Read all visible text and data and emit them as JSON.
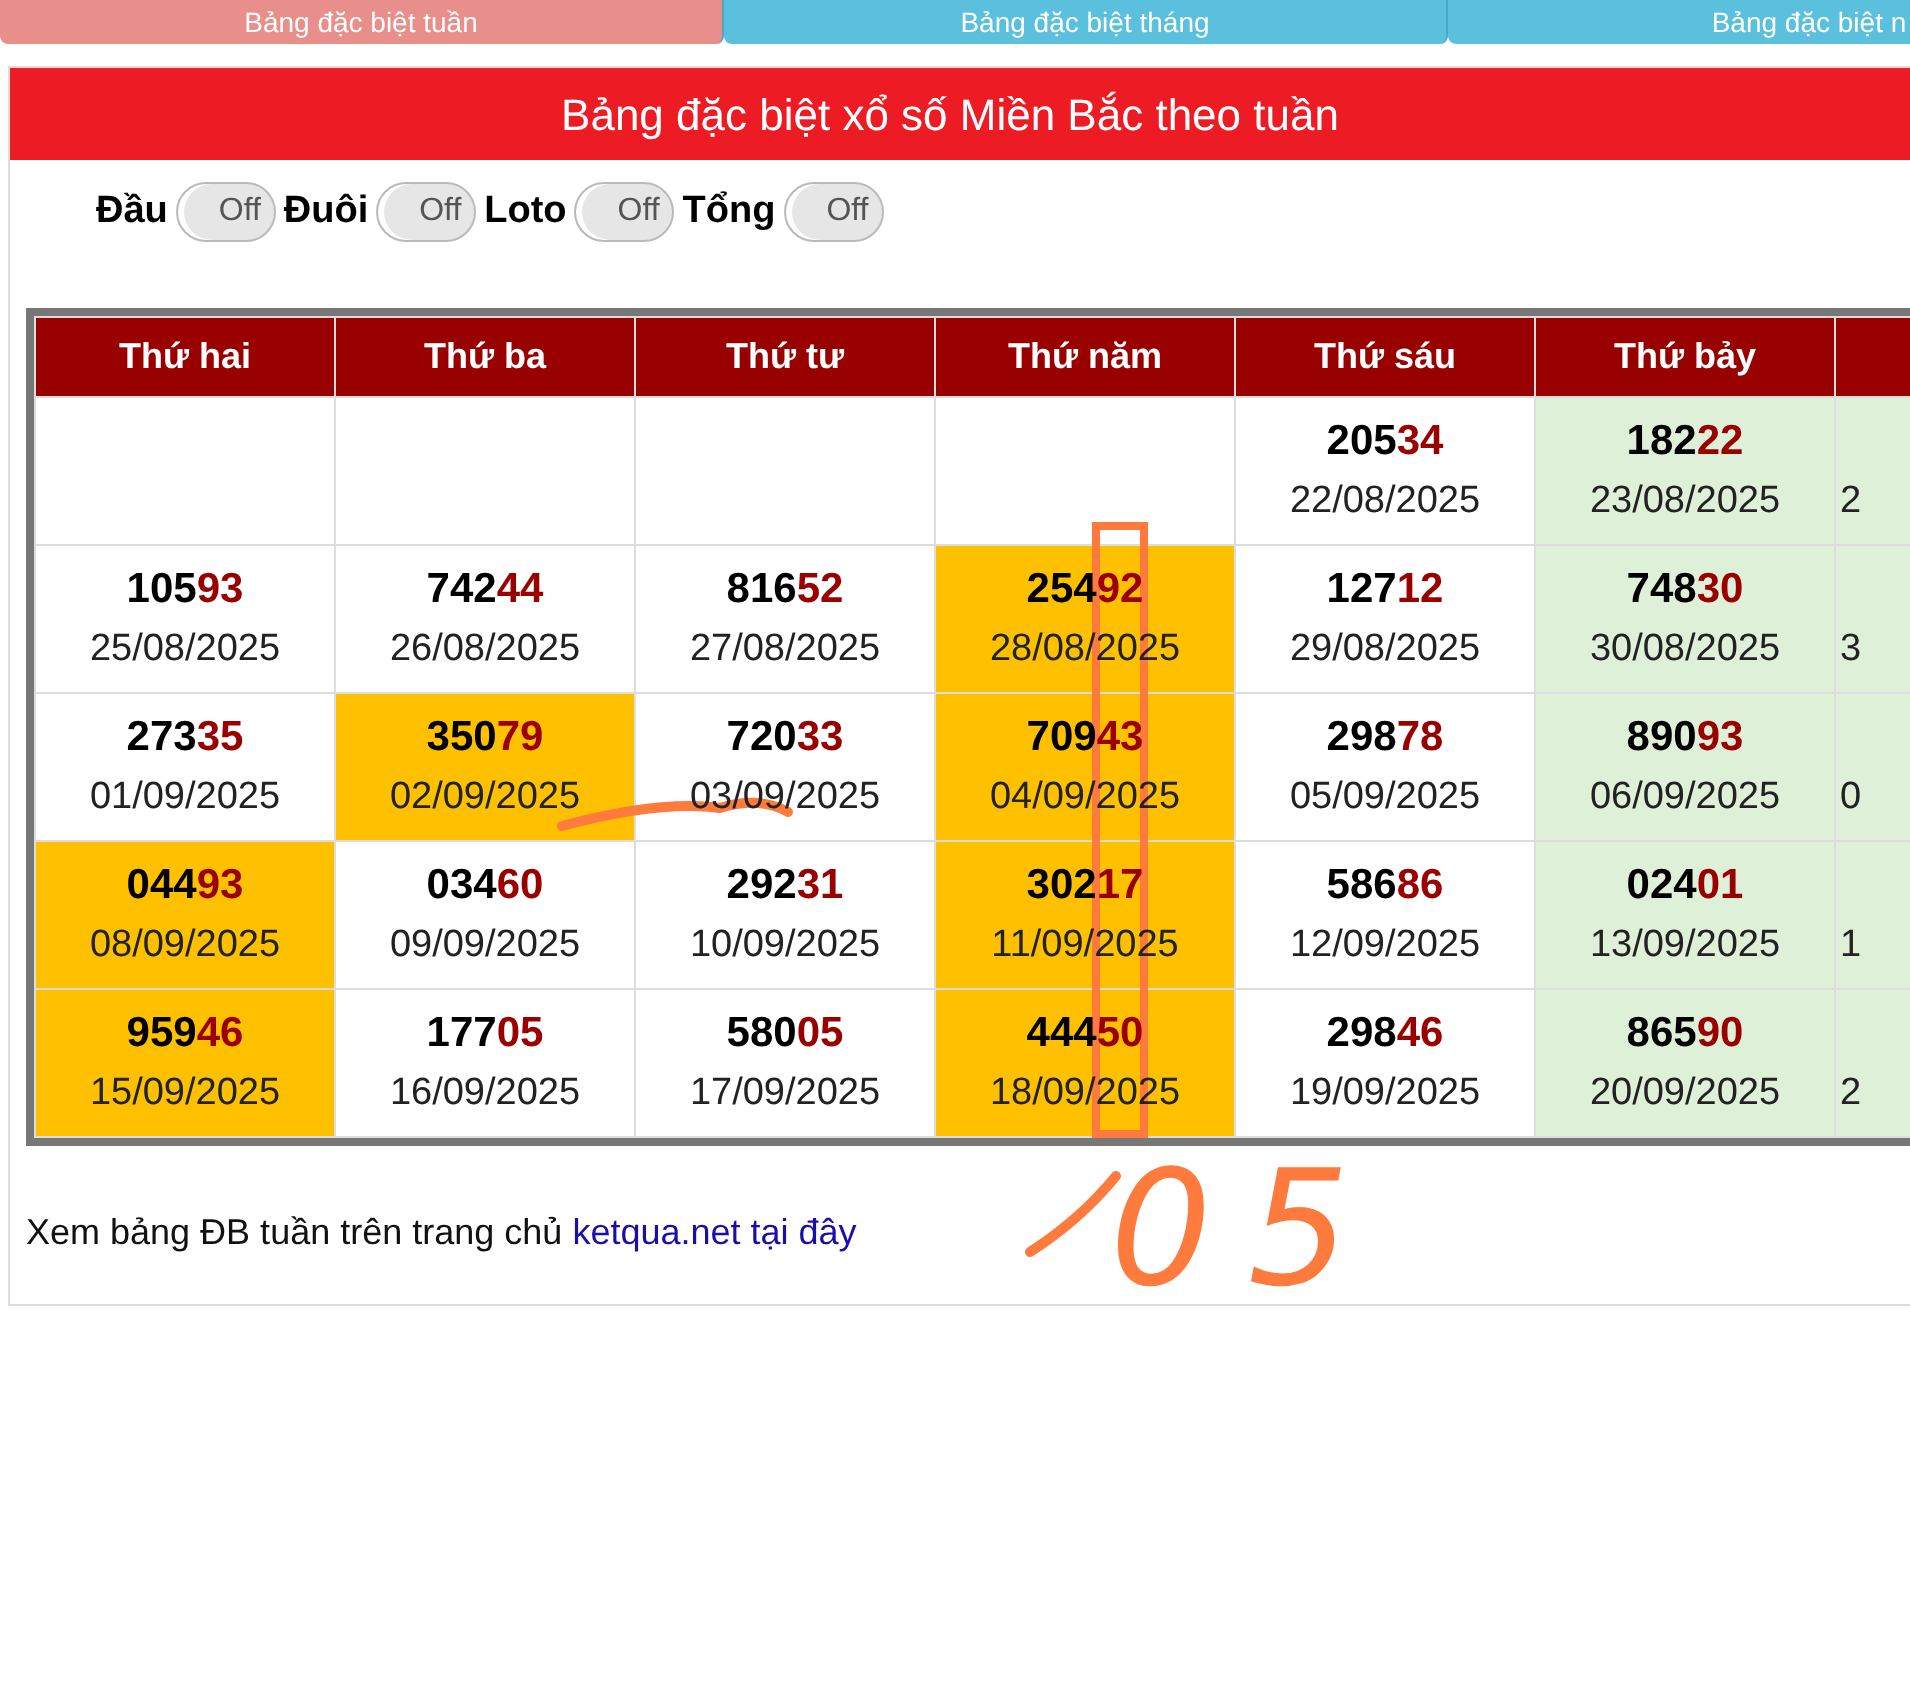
{
  "tabs": [
    {
      "label": "Bảng đặc biệt tuần",
      "selected": true
    },
    {
      "label": "Bảng đặc biệt tháng",
      "selected": false
    },
    {
      "label": "Bảng đặc biệt n",
      "selected": false
    }
  ],
  "title": "Bảng đặc biệt xổ số Miền Bắc theo tuần",
  "toggles": [
    {
      "label": "Đầu",
      "state": "Off",
      "on": false
    },
    {
      "label": "Đuôi",
      "state": "Off",
      "on": false
    },
    {
      "label": "Loto",
      "state": "Off",
      "on": false
    },
    {
      "label": "Tổng",
      "state": "Off",
      "on": false
    }
  ],
  "table": {
    "columns": [
      "Thứ hai",
      "Thứ ba",
      "Thứ tư",
      "Thứ năm",
      "Thứ sáu",
      "Thứ bảy",
      ""
    ],
    "weekend": [
      false,
      false,
      false,
      false,
      false,
      true,
      true
    ],
    "rows": [
      [
        {
          "highlighted": false
        },
        {
          "highlighted": false
        },
        {
          "highlighted": false
        },
        {
          "highlighted": false
        },
        {
          "head": "205",
          "tail": "34",
          "date": "22/08/2025",
          "highlighted": false
        },
        {
          "head": "182",
          "tail": "22",
          "date": "23/08/2025",
          "highlighted": false
        },
        {
          "date": "2",
          "highlighted": false
        }
      ],
      [
        {
          "head": "105",
          "tail": "93",
          "date": "25/08/2025",
          "highlighted": false
        },
        {
          "head": "742",
          "tail": "44",
          "date": "26/08/2025",
          "highlighted": false
        },
        {
          "head": "816",
          "tail": "52",
          "date": "27/08/2025",
          "highlighted": false
        },
        {
          "head": "254",
          "tail": "92",
          "date": "28/08/2025",
          "highlighted": true
        },
        {
          "head": "127",
          "tail": "12",
          "date": "29/08/2025",
          "highlighted": false
        },
        {
          "head": "748",
          "tail": "30",
          "date": "30/08/2025",
          "highlighted": false
        },
        {
          "date": "3",
          "highlighted": false
        }
      ],
      [
        {
          "head": "273",
          "tail": "35",
          "date": "01/09/2025",
          "highlighted": false
        },
        {
          "head": "350",
          "tail": "79",
          "date": "02/09/2025",
          "highlighted": true
        },
        {
          "head": "720",
          "tail": "33",
          "date": "03/09/2025",
          "highlighted": false
        },
        {
          "head": "709",
          "tail": "43",
          "date": "04/09/2025",
          "highlighted": true
        },
        {
          "head": "298",
          "tail": "78",
          "date": "05/09/2025",
          "highlighted": false
        },
        {
          "head": "890",
          "tail": "93",
          "date": "06/09/2025",
          "highlighted": false
        },
        {
          "date": "0",
          "highlighted": false
        }
      ],
      [
        {
          "head": "044",
          "tail": "93",
          "date": "08/09/2025",
          "highlighted": true
        },
        {
          "head": "034",
          "tail": "60",
          "date": "09/09/2025",
          "highlighted": false
        },
        {
          "head": "292",
          "tail": "31",
          "date": "10/09/2025",
          "highlighted": false
        },
        {
          "head": "302",
          "tail": "17",
          "date": "11/09/2025",
          "highlighted": true
        },
        {
          "head": "586",
          "tail": "86",
          "date": "12/09/2025",
          "highlighted": false
        },
        {
          "head": "024",
          "tail": "01",
          "date": "13/09/2025",
          "highlighted": false
        },
        {
          "date": "1",
          "highlighted": false
        }
      ],
      [
        {
          "head": "959",
          "tail": "46",
          "date": "15/09/2025",
          "highlighted": true
        },
        {
          "head": "177",
          "tail": "05",
          "date": "16/09/2025",
          "highlighted": false
        },
        {
          "head": "580",
          "tail": "05",
          "date": "17/09/2025",
          "highlighted": false
        },
        {
          "head": "444",
          "tail": "50",
          "date": "18/09/2025",
          "highlighted": true
        },
        {
          "head": "298",
          "tail": "46",
          "date": "19/09/2025",
          "highlighted": false
        },
        {
          "head": "865",
          "tail": "90",
          "date": "20/09/2025",
          "highlighted": false
        },
        {
          "date": "2",
          "highlighted": false
        }
      ]
    ]
  },
  "footer": {
    "text": "Xem bảng ĐB tuần trên trang chủ",
    "link": "ketqua.net tại đây"
  },
  "annotation": {
    "text": "05"
  }
}
